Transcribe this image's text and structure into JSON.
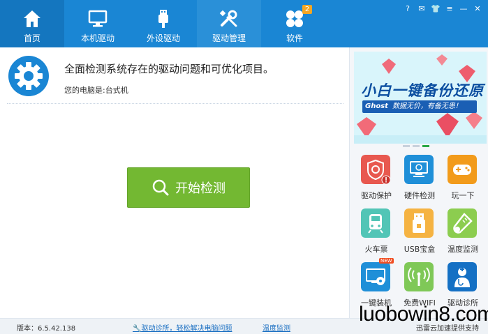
{
  "nav": {
    "tabs": [
      {
        "label": "首页",
        "icon": "home-icon"
      },
      {
        "label": "本机驱动",
        "icon": "monitor-icon"
      },
      {
        "label": "外设驱动",
        "icon": "usb-icon"
      },
      {
        "label": "驱动管理",
        "icon": "tools-icon"
      },
      {
        "label": "软件",
        "icon": "apps-icon",
        "badge": "2"
      }
    ],
    "window_controls": [
      "?",
      "✉",
      "👕",
      "≡",
      "—",
      "✕"
    ]
  },
  "main": {
    "headline": "全面检测系统存在的驱动问题和可优化项目。",
    "pc_type_label": "您的电脑是:台式机",
    "start_button": "开始检测"
  },
  "banner": {
    "title": "小白一键备份还原",
    "ghost_label": "Ghost",
    "ghost_text": "数据无价，有备无患！"
  },
  "apps": [
    {
      "label": "驱动保护",
      "icon": "shield-gear-icon",
      "color": "#e8584f"
    },
    {
      "label": "硬件检测",
      "icon": "monitor-check-icon",
      "color": "#1f8fd8"
    },
    {
      "label": "玩一下",
      "icon": "gamepad-icon",
      "color": "#f29b1b"
    },
    {
      "label": "火车票",
      "icon": "train-icon",
      "color": "#52c5b6"
    },
    {
      "label": "USB宝盒",
      "icon": "usb-box-icon",
      "color": "#f5b342"
    },
    {
      "label": "温度监测",
      "icon": "thermometer-icon",
      "color": "#8ccd4f"
    },
    {
      "label": "一键装机",
      "icon": "install-disc-icon",
      "color": "#1f8fd8",
      "new": "NEW"
    },
    {
      "label": "免费WIFI",
      "icon": "wifi-icon",
      "color": "#7fc857"
    },
    {
      "label": "驱动诊所",
      "icon": "doctor-icon",
      "color": "#1470c4"
    }
  ],
  "footer": {
    "version": "版本：6.5.42.138",
    "link_diagnose": "驱动诊所，轻松解决电脑问题",
    "link_temp": "温度监测",
    "support": "迅雷云加速提供支持"
  },
  "watermark": "luobowin8.com",
  "colors": {
    "topbar": "#1a86d4",
    "start_button": "#73b832"
  }
}
